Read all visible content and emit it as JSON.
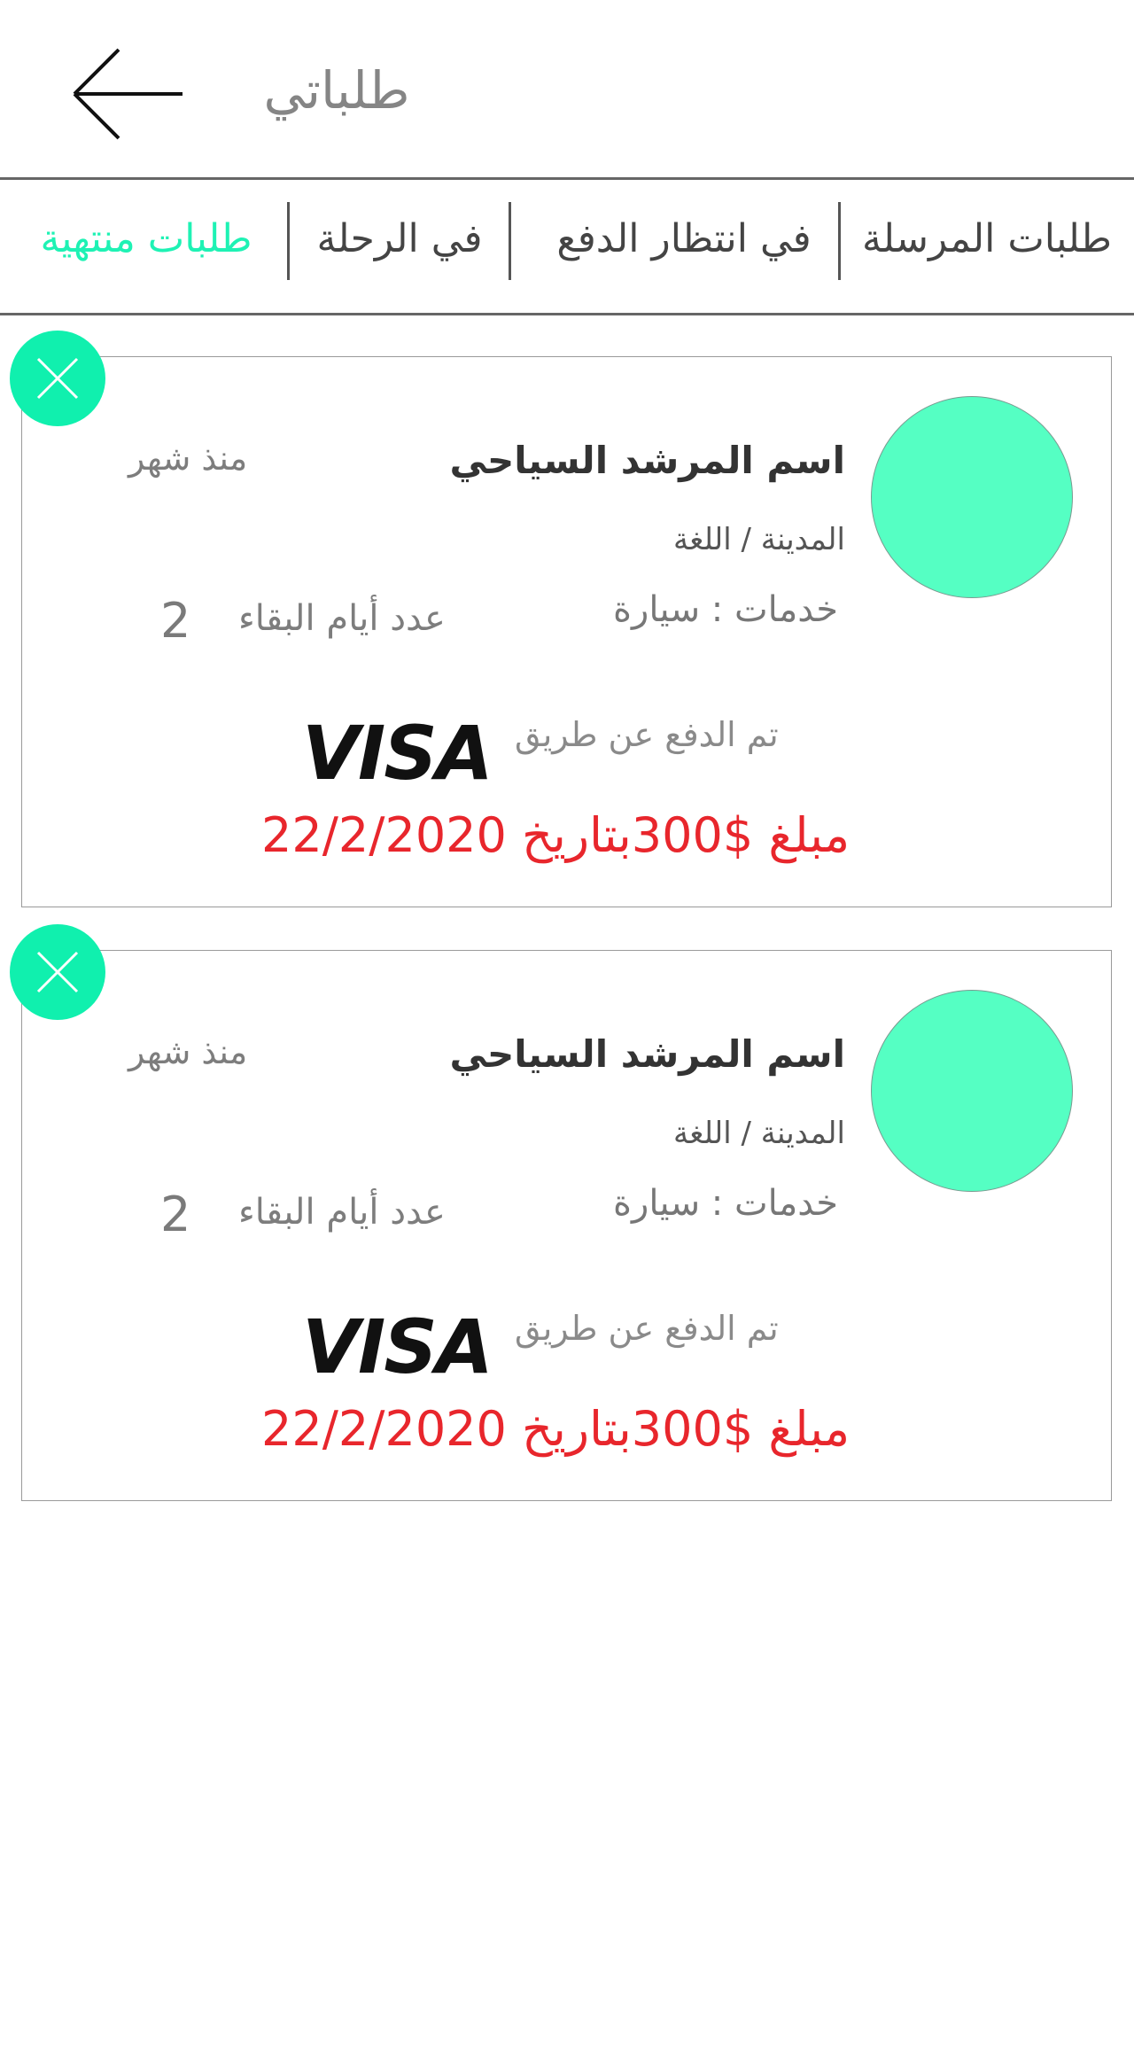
{
  "header": {
    "title": "طلباتي",
    "back_icon": "arrow-left-icon"
  },
  "tabs": [
    {
      "label": "طلبات المرسلة",
      "active": false
    },
    {
      "label": "في انتظار الدفع",
      "active": false
    },
    {
      "label": "في الرحلة",
      "active": false
    },
    {
      "label": "طلبات منتهية",
      "active": true
    }
  ],
  "colors": {
    "accent": "#1ef2b4",
    "close_button": "#10f0ae",
    "avatar": "#55ffc3",
    "amount": "#e8262c"
  },
  "orders": [
    {
      "guide_name": "اسم المرشد السياحي",
      "since": "منذ شهر",
      "city_language": "المدينة / اللغة",
      "services": "خدمات : سيارة",
      "days_label": "عدد أيام البقاء",
      "days_value": "2",
      "paid_via_label": "تم الدفع عن طريق",
      "payment_brand": "VISA",
      "amount_line": "مبلغ  $300بتاريخ 22/2/2020"
    },
    {
      "guide_name": "اسم المرشد السياحي",
      "since": "منذ شهر",
      "city_language": "المدينة / اللغة",
      "services": "خدمات : سيارة",
      "days_label": "عدد أيام البقاء",
      "days_value": "2",
      "paid_via_label": "تم الدفع عن طريق",
      "payment_brand": "VISA",
      "amount_line": "مبلغ  $300بتاريخ 22/2/2020"
    }
  ]
}
